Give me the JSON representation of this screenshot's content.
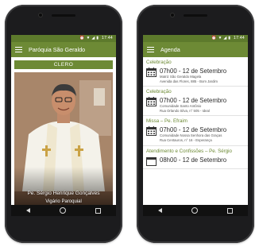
{
  "status_bar": {
    "icons": "⏰ ▼ ◢ ▮",
    "time": "17:44"
  },
  "left_screen": {
    "title": "Paróquia São Geraldo",
    "section_header": "CLERO",
    "person": {
      "name": "Pe. Sérgio Henrique Gonçalves",
      "role": "Vigário Paroquial"
    }
  },
  "right_screen": {
    "title": "Agenda",
    "events": [
      {
        "title": "Celebração",
        "time": "07h00 - 12 de Setembro",
        "place_line1": "Matriz São Geraldo Magela",
        "place_line2": "Avenida das Flores, 885 - Bom Jardim"
      },
      {
        "title": "Celebração",
        "time": "07h00 - 12 de Setembro",
        "place_line1": "Comunidade Santo Antônio",
        "place_line2": "Rua Orlando Silva, n° 505 - Ideal"
      },
      {
        "title": "Missa – Pe. Efraim",
        "time": "07h00 - 12 de Setembro",
        "place_line1": "Comunidade Nossa Senhora das Graças",
        "place_line2": "Rua Centauros, n° 16 - Esperança"
      },
      {
        "title": "Atendimento e Confissões – Pe. Sérgio",
        "time": "08h00 - 12 de Setembro",
        "place_line1": "",
        "place_line2": ""
      }
    ]
  },
  "colors": {
    "primary": "#6d8a35",
    "status": "#5d7a2c",
    "phone": "#1c1c1e"
  },
  "icons": {
    "menu": "hamburger-icon",
    "calendar": "calendar-icon",
    "back": "back-icon",
    "home": "home-icon",
    "recent": "recent-apps-icon"
  }
}
